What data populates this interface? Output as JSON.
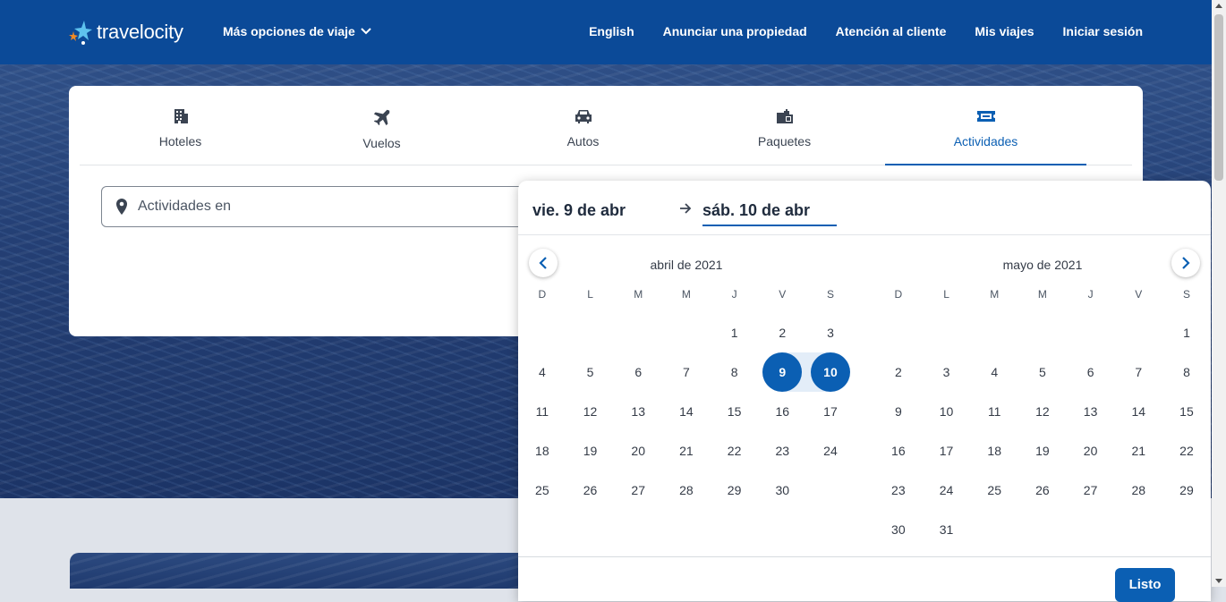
{
  "header": {
    "logo_text": "travelocity",
    "more_options": "Más opciones de viaje",
    "nav": [
      "English",
      "Anunciar una propiedad",
      "Atención al cliente",
      "Mis viajes",
      "Iniciar sesión"
    ]
  },
  "tabs": [
    {
      "label": "Hoteles",
      "icon": "building-icon"
    },
    {
      "label": "Vuelos",
      "icon": "airplane-icon"
    },
    {
      "label": "Autos",
      "icon": "car-icon"
    },
    {
      "label": "Paquetes",
      "icon": "luggage-icon"
    },
    {
      "label": "Actividades",
      "icon": "ticket-icon",
      "active": true
    }
  ],
  "search": {
    "destination_placeholder": "Actividades en"
  },
  "calendar": {
    "start_date": "vie. 9 de abr",
    "end_date": "sáb. 10 de abr",
    "weekdays": [
      "D",
      "L",
      "M",
      "M",
      "J",
      "V",
      "S"
    ],
    "months": [
      {
        "title": "abril de 2021",
        "first_weekday": 4,
        "days": 30
      },
      {
        "title": "mayo de 2021",
        "first_weekday": 6,
        "days": 31
      }
    ],
    "selected": {
      "month": 0,
      "start": 9,
      "end": 10
    },
    "done_label": "Listo"
  },
  "colors": {
    "header_bg": "#0b4a98",
    "accent": "#0b5fb3",
    "range_bg": "#e3edf8"
  }
}
